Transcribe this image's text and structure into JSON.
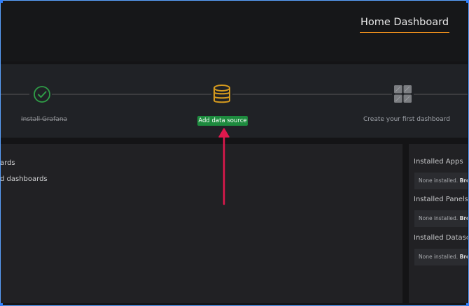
{
  "header": {
    "title": "Home Dashboard"
  },
  "steps": [
    {
      "label": "Install Grafana",
      "icon": "check-circle-icon",
      "state": "done"
    },
    {
      "label": "Add data source",
      "icon": "database-icon",
      "state": "active"
    },
    {
      "label": "Create your first dashboard",
      "icon": "dashboard-grid-icon",
      "state": "pending"
    }
  ],
  "left_panel": {
    "items": [
      "ards",
      "d dashboards"
    ]
  },
  "right_panel": {
    "sections": [
      {
        "heading": "Installed Apps",
        "none_text": "None installed.",
        "link_text": "Bro"
      },
      {
        "heading": "Installed Panels",
        "none_text": "None installed.",
        "link_text": "Bro"
      },
      {
        "heading": "Installed Datasou",
        "none_text": "None installed.",
        "link_text": "Bro"
      }
    ]
  },
  "colors": {
    "accent_orange": "#e78b1c",
    "done_green": "#1d8b3e",
    "active_amber": "#d59a1e",
    "annotation_red": "#e0184d"
  }
}
